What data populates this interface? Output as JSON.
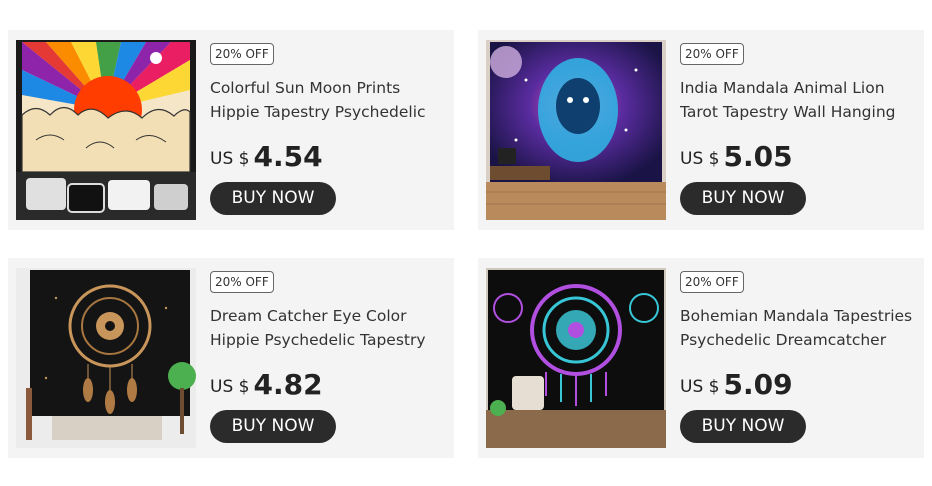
{
  "products": [
    {
      "discount": "20% OFF",
      "title_line1": "Colorful Sun Moon Prints",
      "title_line2": "Hippie Tapestry Psychedelic",
      "currency": "US $",
      "price": "4.54",
      "button": "BUY NOW"
    },
    {
      "discount": "20% OFF",
      "title_line1": "India Mandala Animal Lion",
      "title_line2": "Tarot Tapestry Wall Hanging",
      "currency": "US $",
      "price": "5.05",
      "button": "BUY NOW"
    },
    {
      "discount": "20% OFF",
      "title_line1": "Dream Catcher Eye Color",
      "title_line2": "Hippie Psychedelic Tapestry",
      "currency": "US $",
      "price": "4.82",
      "button": "BUY NOW"
    },
    {
      "discount": "20% OFF",
      "title_line1": "Bohemian Mandala Tapestries",
      "title_line2": "Psychedelic Dreamcatcher",
      "currency": "US $",
      "price": "5.09",
      "button": "BUY NOW"
    }
  ]
}
